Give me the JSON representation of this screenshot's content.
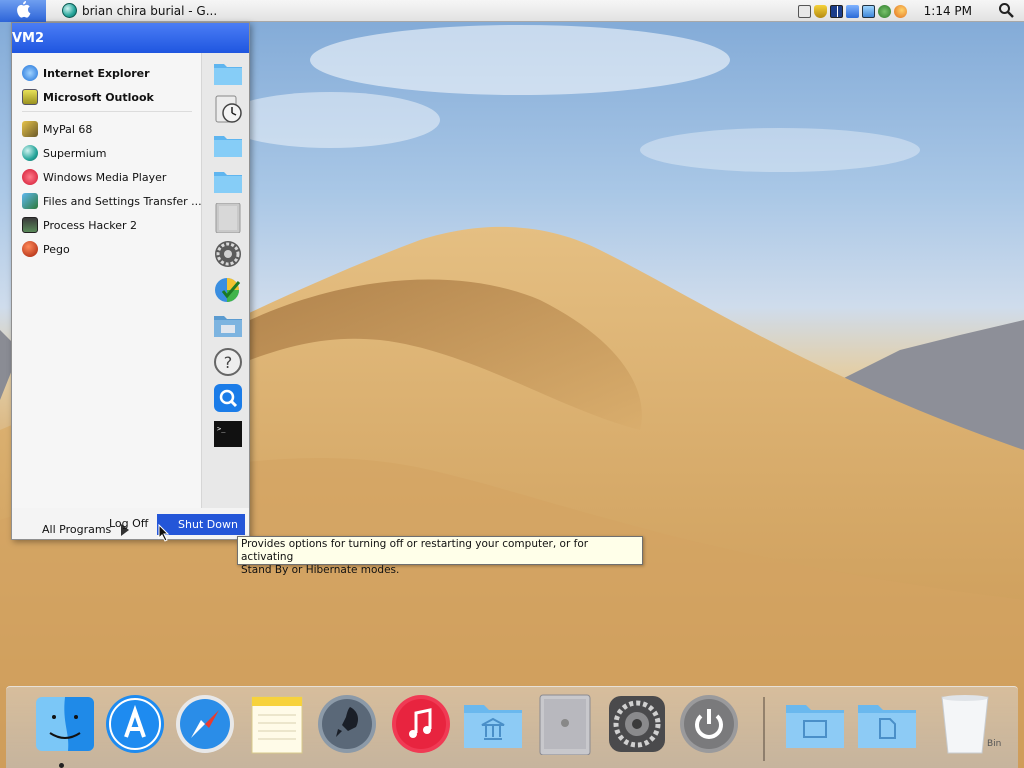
{
  "window_task": {
    "title": "brian chira burial - G..."
  },
  "clock": {
    "time": "1:14 PM"
  },
  "tray_icons": [
    "keyboard-icon",
    "security-shield-icon",
    "grid-icon",
    "network-icon",
    "monitor-icon",
    "recycle-icon",
    "magnifier-icon"
  ],
  "start_menu": {
    "user": "VM2",
    "pinned": [
      {
        "label": "Internet Explorer",
        "icon": "internet-explorer-icon"
      },
      {
        "label": "Microsoft Outlook",
        "icon": "outlook-icon"
      }
    ],
    "recent": [
      {
        "label": "MyPal 68",
        "icon": "mypal-icon"
      },
      {
        "label": "Supermium",
        "icon": "supermium-icon"
      },
      {
        "label": "Windows Media Player",
        "icon": "media-player-icon"
      },
      {
        "label": "Files and Settings Transfer ...",
        "icon": "transfer-wizard-icon"
      },
      {
        "label": "Process Hacker 2",
        "icon": "process-hacker-icon"
      },
      {
        "label": "Pego",
        "icon": "pego-icon"
      }
    ],
    "right_icons": [
      "documents-folder-icon",
      "time-icon",
      "pictures-folder-icon",
      "music-folder-icon",
      "computer-icon",
      "settings-gear-icon",
      "program-access-icon",
      "printers-folder-icon",
      "help-icon",
      "search-icon",
      "terminal-icon"
    ],
    "all_programs": "All Programs",
    "log_off": "Log Off",
    "shut_down": "Shut Down"
  },
  "tooltip": {
    "line1": "Provides options for turning off or restarting your computer, or for activating",
    "line2": "Stand By or Hibernate modes."
  },
  "dock": {
    "items": [
      "finder-icon",
      "app-store-icon",
      "safari-icon",
      "notes-icon",
      "launchpad-icon",
      "itunes-icon",
      "applications-folder-icon",
      "mac-pro-icon",
      "system-preferences-icon",
      "power-icon",
      "downloads-folder-icon",
      "documents-folder-icon",
      "trash-icon"
    ],
    "bin_label": "Bin"
  }
}
